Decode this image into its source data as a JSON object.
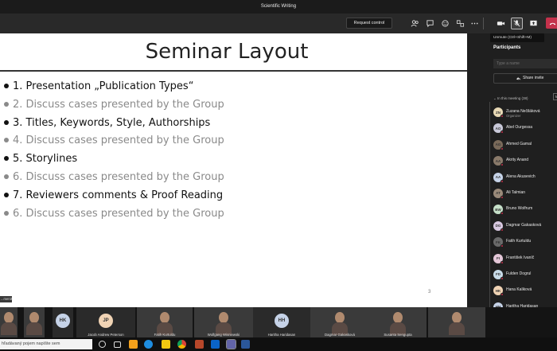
{
  "window": {
    "title": "Scientific Writing"
  },
  "toolbar": {
    "request_control_label": "Request control",
    "icons": [
      "people-icon",
      "chat-icon",
      "reactions-icon",
      "rooms-icon",
      "more-icon",
      "camera-icon",
      "mic-off-icon",
      "share-icon",
      "leave-icon"
    ]
  },
  "tooltip": {
    "text": "Unmute (Ctrl+Shift+M)"
  },
  "slide": {
    "title": "Seminar Layout",
    "page_number": "3",
    "bullets": [
      {
        "text": "1. Presentation „Publication Types“",
        "style": "dark"
      },
      {
        "text": "2. Discuss cases presented by the Group",
        "style": "grey"
      },
      {
        "text": "3. Titles, Keywords, Style, Authorships",
        "style": "dark"
      },
      {
        "text": "4. Discuss cases presented by the Group",
        "style": "grey"
      },
      {
        "text": "5. Storylines",
        "style": "dark"
      },
      {
        "text": "6. Discuss cases presented by the Group",
        "style": "grey"
      },
      {
        "text": "7. Reviewers comments & Proof Reading",
        "style": "dark"
      },
      {
        "text": "6. Discuss cases presented by the Group",
        "style": "grey"
      }
    ],
    "presenter_chip": "...menik"
  },
  "participants": {
    "title": "Participants",
    "search_placeholder": "Type a name",
    "share_invite_label": "Share invite",
    "in_meeting_label": "In this meeting (38)",
    "mute_all_label": "M",
    "people": [
      {
        "name": "Zuzana Nečiláková",
        "role": "Organizer",
        "initials": "ZN",
        "color": "#e8d9b5"
      },
      {
        "name": "Abel Ourgessa",
        "role": "",
        "initials": "AO",
        "color": "#c9c9d9"
      },
      {
        "name": "Ahmed Gamal",
        "role": "",
        "initials": "AG",
        "color": "#7a6a5a"
      },
      {
        "name": "Akrity Anand",
        "role": "",
        "initials": "AA",
        "color": "#8a7a6a"
      },
      {
        "name": "Alena Akusevich",
        "role": "",
        "initials": "AA",
        "color": "#c6d3e8"
      },
      {
        "name": "Ali Talmian",
        "role": "",
        "initials": "AT",
        "color": "#9a8a7a"
      },
      {
        "name": "Bruno Wolfrum",
        "role": "",
        "initials": "BW",
        "color": "#c6e0c9"
      },
      {
        "name": "Dagmar Gakasková",
        "role": "",
        "initials": "DG",
        "color": "#d8c8e0"
      },
      {
        "name": "Fatih Kurtuldu",
        "role": "",
        "initials": "FK",
        "color": "#6a6a6a"
      },
      {
        "name": "František Ivaníč",
        "role": "",
        "initials": "FI",
        "color": "#e4c7d8"
      },
      {
        "name": "Fulden Dogrul",
        "role": "",
        "initials": "FD",
        "color": "#c8dbe8"
      },
      {
        "name": "Hana Kaliková",
        "role": "",
        "initials": "HK",
        "color": "#f0d3b4"
      },
      {
        "name": "Haritha Haridasan",
        "role": "",
        "initials": "HH",
        "color": "#c6d3e8"
      },
      {
        "name": "Hossein Kandi",
        "role": "",
        "initials": "HK",
        "color": "#c6d3e8"
      }
    ]
  },
  "video_strip": {
    "tiles": [
      {
        "label": "",
        "type": "photo",
        "initials": ""
      },
      {
        "label": "",
        "type": "photo",
        "initials": ""
      },
      {
        "label": "",
        "type": "initials",
        "initials": "HK",
        "color": "#c6d3e8"
      },
      {
        "label": "Jacob Andrew Peterson",
        "type": "initials",
        "initials": "JP",
        "color": "#f0d3b4"
      },
      {
        "label": "Fatih Kurtuldu",
        "type": "photo",
        "initials": ""
      },
      {
        "label": "Wolfgang Wisniewski",
        "type": "photo",
        "initials": ""
      },
      {
        "label": "Haritha Haridasan",
        "type": "initials",
        "initials": "HH",
        "color": "#c6d3e8"
      },
      {
        "label": "Dagmar Gakasková",
        "type": "photo",
        "initials": ""
      },
      {
        "label": "Susanta Sengupta",
        "type": "photo",
        "initials": ""
      },
      {
        "label": "",
        "type": "photo",
        "initials": ""
      }
    ]
  },
  "taskbar": {
    "search_text": "hľadávaný pojem napíšte sem"
  }
}
